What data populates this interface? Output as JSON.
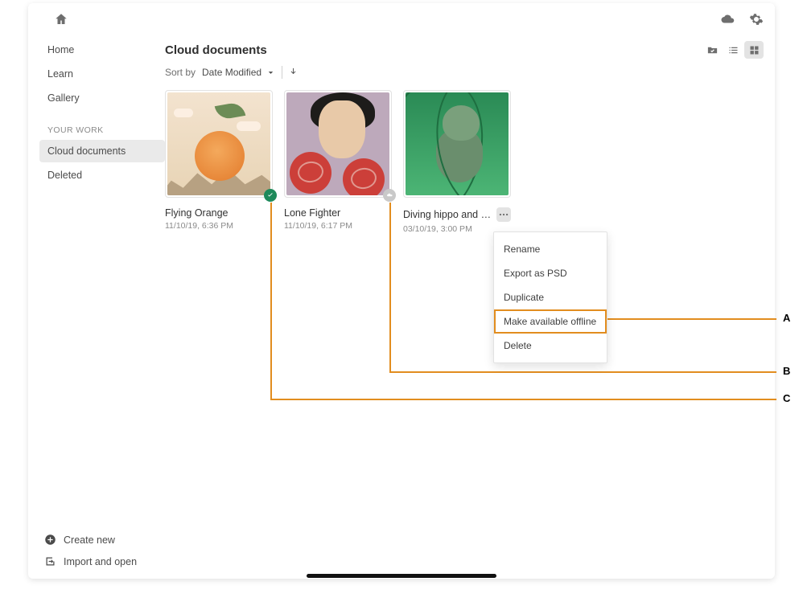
{
  "header": {},
  "sidebar": {
    "items": [
      {
        "label": "Home"
      },
      {
        "label": "Learn"
      },
      {
        "label": "Gallery"
      }
    ],
    "workHead": "YOUR WORK",
    "workItems": [
      {
        "label": "Cloud documents"
      },
      {
        "label": "Deleted"
      }
    ],
    "createLabel": "Create new",
    "importLabel": "Import and open"
  },
  "main": {
    "title": "Cloud documents",
    "sortLabel": "Sort by",
    "sortValue": "Date Modified"
  },
  "cards": [
    {
      "title": "Flying Orange",
      "date": "11/10/19, 6:36 PM"
    },
    {
      "title": "Lone Fighter",
      "date": "11/10/19, 6:17 PM"
    },
    {
      "title": "Diving hippo and the…",
      "date": "03/10/19, 3:00 PM"
    }
  ],
  "ctx": {
    "items": [
      "Rename",
      "Export as PSD",
      "Duplicate",
      "Make available offline",
      "Delete"
    ]
  },
  "ann": {
    "A": "A",
    "B": "B",
    "C": "C"
  }
}
